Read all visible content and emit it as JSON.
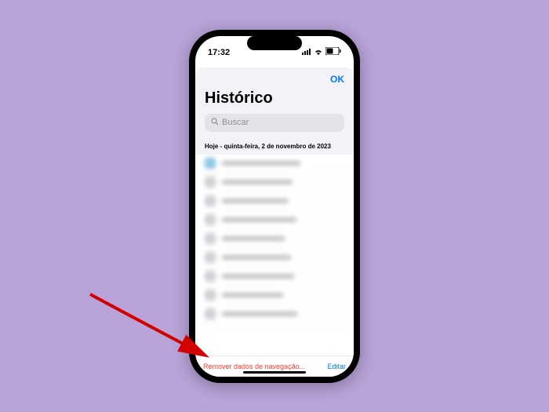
{
  "statusBar": {
    "time": "17:32",
    "batteryText": "51"
  },
  "sheet": {
    "okButton": "OK",
    "title": "Histórico"
  },
  "search": {
    "placeholder": "Buscar"
  },
  "section": {
    "today": "Hoje - quinta-feira, 2 de novembro de 2023"
  },
  "actionBar": {
    "remove": "Remover dados de navegação...",
    "edit": "Editar"
  },
  "colors": {
    "accent": "#007aff",
    "destructive": "#ff3b30",
    "background": "#b9a3d9"
  }
}
